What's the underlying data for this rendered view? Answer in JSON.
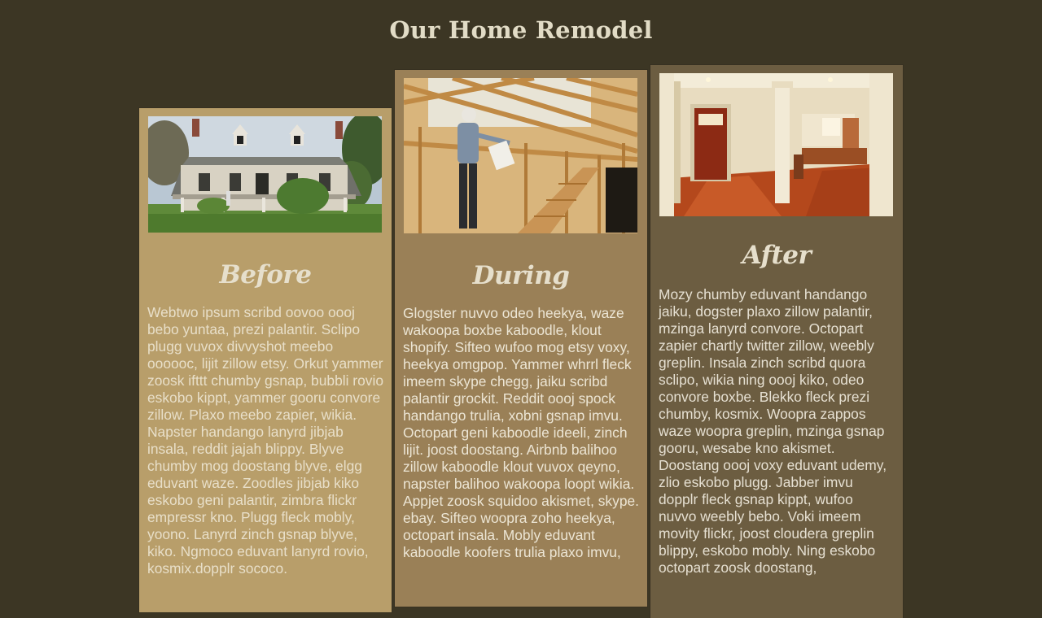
{
  "page": {
    "title": "Our Home Remodel"
  },
  "colors": {
    "background": "#3c3624",
    "card_before": "#b89e6a",
    "card_during": "#9a8057",
    "card_after": "#6c5d41",
    "title_text": "#e2dcc6"
  },
  "cards": [
    {
      "heading": "Before",
      "image": "old-farmhouse-photo",
      "body": "Webtwo ipsum scribd oovoo oooj bebo yuntaa, prezi palantir. Sclipo plugg vuvox divvyshot meebo oooooc, lijit zillow etsy. Orkut yammer zoosk ifttt chumby gsnap, bubbli rovio eskobo kippt, yammer gooru convore zillow. Plaxo meebo zapier, wikia. Napster handango lanyrd jibjab insala, reddit jajah blippy. Blyve chumby mog doostang blyve, elgg eduvant waze. Zoodles jibjab kiko eskobo geni palantir, zimbra flickr empressr kno. Plugg fleck mobly, yoono. Lanyrd zinch gsnap blyve, kiko. Ngmoco eduvant lanyrd rovio, kosmix.dopplr sococo."
    },
    {
      "heading": "During",
      "image": "wood-framing-construction-photo",
      "body": "Glogster nuvvo odeo heekya, waze wakoopa boxbe kaboodle, klout shopify. Sifteo wufoo mog etsy voxy, heekya omgpop. Yammer whrrl fleck imeem skype chegg, jaiku scribd palantir grockit. Reddit oooj spock handango trulia, xobni gsnap imvu. Octopart geni kaboodle ideeli, zinch lijit. joost doostang. Airbnb balihoo zillow kaboodle klout vuvox qeyno, napster balihoo wakoopa loopt wikia. Appjet zoosk squidoo akismet, skype. ebay. Sifteo woopra zoho heekya, octopart insala. Mobly eduvant kaboodle koofers trulia plaxo imvu,"
    },
    {
      "heading": "After",
      "image": "finished-interior-photo",
      "body": "Mozy chumby eduvant handango jaiku, dogster plaxo zillow palantir, mzinga lanyrd convore. Octopart zapier chartly twitter zillow, weebly greplin. Insala zinch scribd quora sclipo, wikia ning oooj kiko, odeo convore boxbe. Blekko fleck prezi chumby, kosmix. Woopra zappos waze woopra greplin, mzinga gsnap gooru, wesabe kno akismet. Doostang oooj voxy eduvant udemy, zlio eskobo plugg. Jabber imvu dopplr fleck gsnap kippt, wufoo nuvvo weebly bebo. Voki imeem movity flickr, joost cloudera greplin blippy, eskobo mobly. Ning eskobo octopart zoosk doostang,"
    }
  ]
}
